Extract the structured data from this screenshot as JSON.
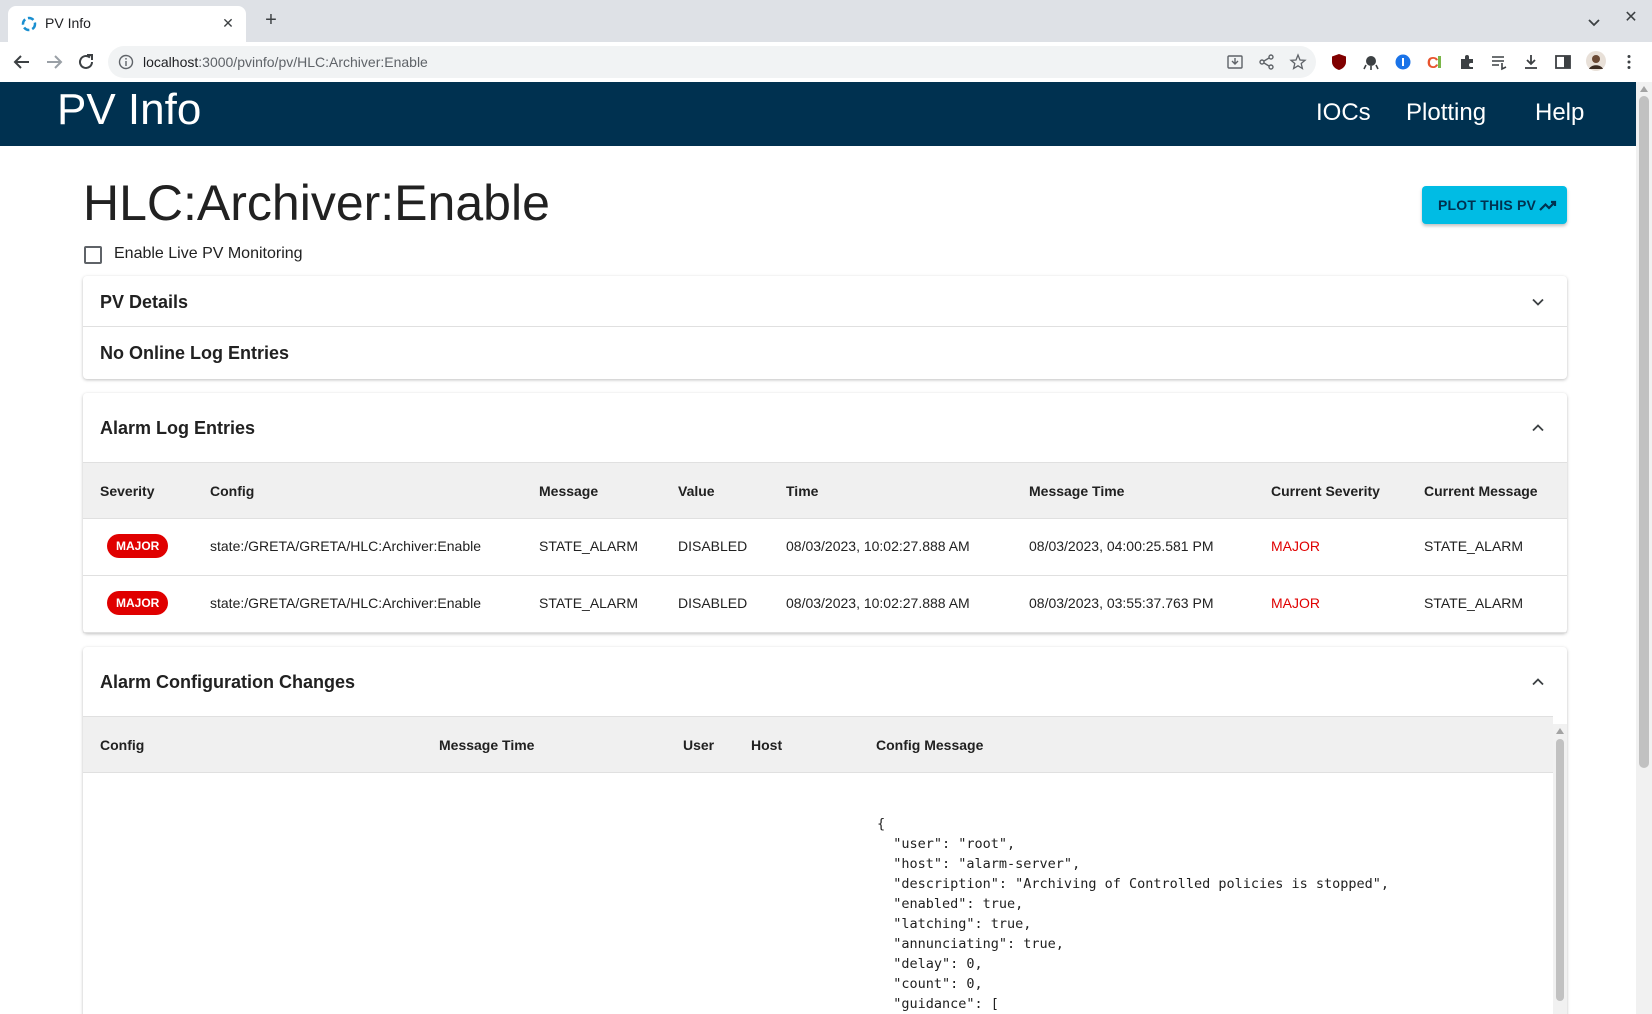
{
  "browser": {
    "tab_title": "PV Info",
    "url_host": "localhost",
    "url_path": ":3000/pvinfo/pv/HLC:Archiver:Enable",
    "tab_close": "✕",
    "new_tab": "+",
    "window_close": "✕"
  },
  "app": {
    "logo": "PV Info",
    "nav": [
      "IOCs",
      "Plotting",
      "Help"
    ]
  },
  "pv": {
    "name": "HLC:Archiver:Enable",
    "plot_button": "PLOT THIS PV",
    "live_monitoring_label": "Enable Live PV Monitoring",
    "live_monitoring_checked": false
  },
  "pv_details": {
    "title": "PV Details"
  },
  "online_log": {
    "title": "No Online Log Entries"
  },
  "alarm_log": {
    "title": "Alarm Log Entries",
    "columns": [
      "Severity",
      "Config",
      "Message",
      "Value",
      "Time",
      "Message Time",
      "Current Severity",
      "Current Message"
    ],
    "rows": [
      {
        "severity": "MAJOR",
        "config": "state:/GRETA/GRETA/HLC:Archiver:Enable",
        "message": "STATE_ALARM",
        "value": "DISABLED",
        "time": "08/03/2023, 10:02:27.888 AM",
        "message_time": "08/03/2023, 04:00:25.581 PM",
        "current_severity": "MAJOR",
        "current_message": "STATE_ALARM"
      },
      {
        "severity": "MAJOR",
        "config": "state:/GRETA/GRETA/HLC:Archiver:Enable",
        "message": "STATE_ALARM",
        "value": "DISABLED",
        "time": "08/03/2023, 10:02:27.888 AM",
        "message_time": "08/03/2023, 03:55:37.763 PM",
        "current_severity": "MAJOR",
        "current_message": "STATE_ALARM"
      }
    ]
  },
  "alarm_config": {
    "title": "Alarm Configuration Changes",
    "columns": [
      "Config",
      "Message Time",
      "User",
      "Host",
      "Config Message"
    ],
    "config_message_lines": [
      "{",
      "  \"user\": \"root\",",
      "  \"host\": \"alarm-server\",",
      "  \"description\": \"Archiving of Controlled policies is stopped\",",
      "  \"enabled\": true,",
      "  \"latching\": true,",
      "  \"annunciating\": true,",
      "  \"delay\": 0,",
      "  \"count\": 0,",
      "  \"guidance\": [",
      "    {"
    ]
  },
  "colors": {
    "header_bg": "#003150",
    "accent_button": "#00bce4",
    "severity_major": "#e00000"
  }
}
